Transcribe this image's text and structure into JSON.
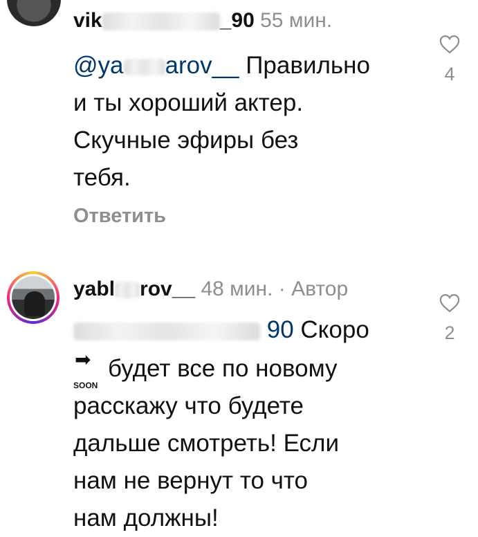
{
  "comments": [
    {
      "username_visible_start": "vik",
      "username_visible_end": "_90",
      "time": "55 мин.",
      "mention_start": "@ya",
      "mention_end": "arov__",
      "text_line1": "Правильно",
      "text_line2": "и ты хороший актер.",
      "text_line3": "Скучные эфиры без",
      "text_line4": "тебя.",
      "reply_label": "Ответить",
      "like_count": "4"
    },
    {
      "username_visible_start": "yabl",
      "username_visible_end": "rov__",
      "time": "48 мин.",
      "author_badge": "· Автор",
      "mention_end": "90",
      "text_line1": "Скоро",
      "emoji_arrow": "➡",
      "emoji_label": "SOON",
      "text_line2": "будет все по новому",
      "text_line3": "расскажу что будете",
      "text_line4": "дальше смотреть! Если",
      "text_line5": "нам не вернут то что",
      "text_line6": "нам должны!",
      "like_count": "2"
    }
  ]
}
